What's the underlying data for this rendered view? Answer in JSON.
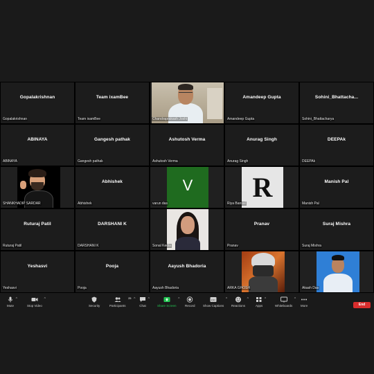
{
  "tiles": [
    {
      "name": "Gopalakrishnan",
      "label": "Gopalakrishnan"
    },
    {
      "name": "Team ixamBee",
      "label": "Team ixamBee"
    },
    {
      "name": "",
      "label": "Chandraprakash Joshi"
    },
    {
      "name": "Amandeep Gupta",
      "label": "Amandeep Gupta"
    },
    {
      "name": "Sohini_Bhattacha...",
      "label": "Sohini_Bhattacharya"
    },
    {
      "name": "ABINAYA",
      "label": "ABINAYA"
    },
    {
      "name": "Gangesh pathak",
      "label": "Gangesh pathak"
    },
    {
      "name": "Ashutosh Verma",
      "label": "Ashutosh Verma"
    },
    {
      "name": "Anurag Singh",
      "label": "Anurag Singh"
    },
    {
      "name": "DEEPAk",
      "label": "DEEPAk"
    },
    {
      "name": "",
      "label": "SHANKHADIP SARDAR"
    },
    {
      "name": "Abhishek",
      "label": "Abhishek"
    },
    {
      "name": "",
      "label": "varun das",
      "avatar_letter": "V",
      "avatar_color": "#1f6b1f"
    },
    {
      "name": "",
      "label": "Riya Bansal",
      "avatar_letter": "R",
      "avatar_color": "#e6e6e6"
    },
    {
      "name": "Manish Pal",
      "label": "Manish Pal"
    },
    {
      "name": "Ruturaj Patil",
      "label": "Ruturaj Patil"
    },
    {
      "name": "DARSHANI K",
      "label": "DARSHANI K"
    },
    {
      "name": "",
      "label": "Sonal Kedia"
    },
    {
      "name": "Pranav",
      "label": "Pranav"
    },
    {
      "name": "Suraj Mishra",
      "label": "Suraj Mishra"
    },
    {
      "name": "Yeshasvi",
      "label": "Yeshasvi"
    },
    {
      "name": "Pooja",
      "label": "Pooja"
    },
    {
      "name": "Aayush Bhadoria",
      "label": "Aayush Bhadoria"
    },
    {
      "name": "",
      "label": "ARKA GHOSH"
    },
    {
      "name": "",
      "label": "Akash Das"
    }
  ],
  "toolbar": {
    "mute": "Mute",
    "stop_video": "Stop Video",
    "security": "Security",
    "participants": "Participants",
    "participants_count": "25",
    "chat": "Chat",
    "share_screen": "Share Screen",
    "record": "Record",
    "show_captions": "Show Captions",
    "reactions": "Reactions",
    "apps": "Apps",
    "whiteboards": "Whiteboards",
    "more": "More",
    "end": "End"
  },
  "colors": {
    "share_green": "#23c552",
    "end_red": "#d92d2d",
    "background": "#1a1a1a"
  }
}
